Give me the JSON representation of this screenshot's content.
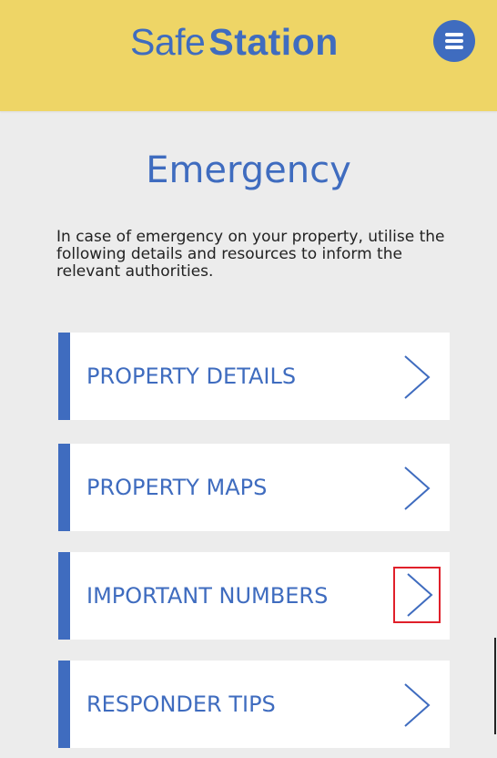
{
  "header": {
    "logo_part1": "Safe",
    "logo_part2": "Station",
    "menu_icon": "hamburger-menu-icon"
  },
  "page": {
    "title": "Emergency",
    "intro": "In case of emergency on your property, utilise the following details and resources to inform the relevant authorities."
  },
  "nav_items": [
    {
      "label": "PROPERTY DETAILS",
      "icon": "chevron-right-icon"
    },
    {
      "label": "PROPERTY MAPS",
      "icon": "chevron-right-icon"
    },
    {
      "label": "IMPORTANT NUMBERS",
      "icon": "chevron-right-icon"
    },
    {
      "label": "RESPONDER TIPS",
      "icon": "chevron-right-icon"
    }
  ],
  "colors": {
    "header_bg": "#eed566",
    "brand_blue": "#3f6cbf",
    "page_bg": "#ececec",
    "card_bg": "#ffffff",
    "highlight": "#e0202a"
  }
}
